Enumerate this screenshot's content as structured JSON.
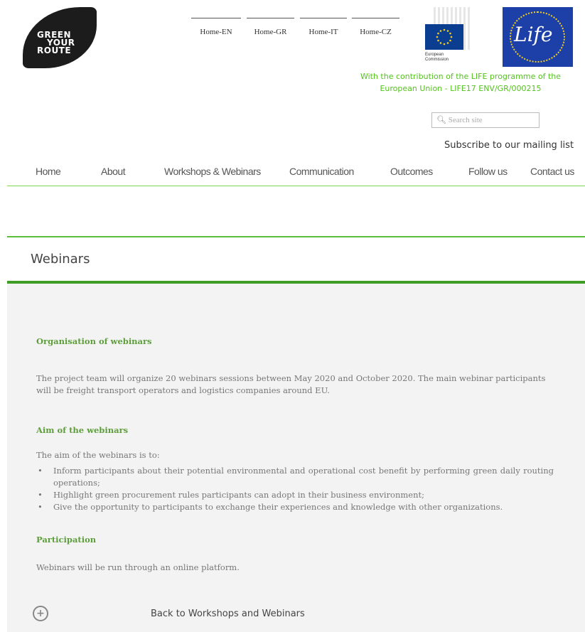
{
  "header": {
    "logo": {
      "lines": [
        "GREEN",
        "YOUR",
        "ROUTE"
      ]
    },
    "languages": [
      "Home-EN",
      "Home-GR",
      "Home-IT",
      "Home-CZ"
    ],
    "ec_logo": {
      "label_line1": "European",
      "label_line2": "Commission"
    },
    "life_logo": {
      "word": "Life"
    },
    "contribution": "With the contribution of the LIFE programme of the European Union - LIFE17 ENV/GR/000215",
    "search": {
      "placeholder": "Search site",
      "icon": "search-icon"
    },
    "subscribe": "Subscribe to our mailing list"
  },
  "nav": {
    "items": [
      "Home",
      "About",
      "Workshops & Webinars",
      "Communication",
      "Outcomes",
      "Follow us",
      "Contact us"
    ]
  },
  "page": {
    "title": "Webinars"
  },
  "content": {
    "section1_heading": "Organisation of webinars",
    "section1_text": "The project team will organize 20 webinars sessions between May 2020 and October 2020. The main webinar participants will be freight transport operators and logistics companies around EU.",
    "section2_heading": "Aim of the webinars",
    "section2_intro": "The aim of the webinars is to:",
    "section2_items": [
      "Inform participants about their potential environmental and operational cost benefit by performing green daily routing operations;",
      "Highlight green procurement rules participants can adopt in their business environment;",
      "Give the opportunity to participants to exchange their experiences and knowledge with other organizations."
    ],
    "section3_heading": "Participation",
    "section3_text": "Webinars will be run through an online platform.",
    "back_icon": "plus-circle-icon",
    "back_link": "Back to Workshops and Webinars"
  },
  "colors": {
    "accent_green": "#5cbf3a",
    "heading_green": "#5d9e3b",
    "contribution_green": "#55c21f",
    "life_blue": "#1c3fa8"
  }
}
